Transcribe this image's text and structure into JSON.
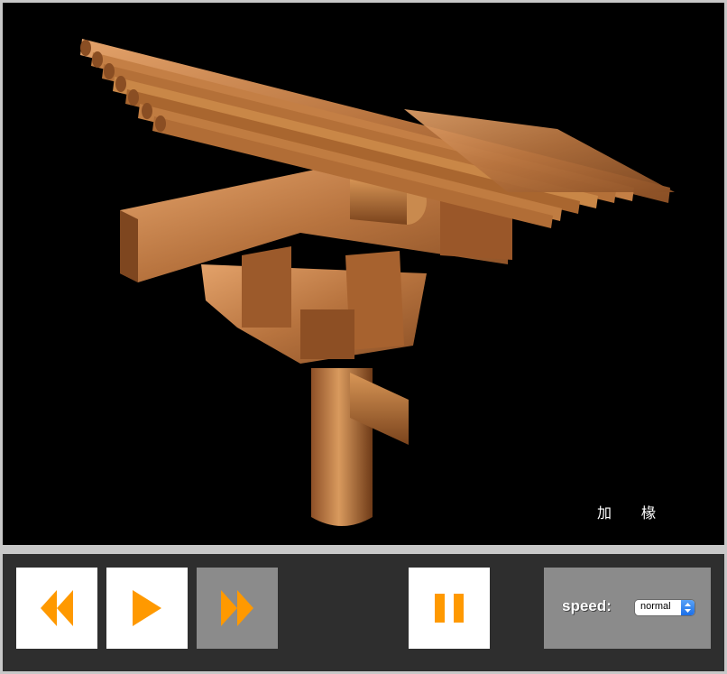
{
  "viewer": {
    "caption": "加 椽",
    "scene": "wooden bracket set (dougong) with rafters on column"
  },
  "controls": {
    "rewind": {
      "icon": "rewind-icon",
      "enabled": true
    },
    "play": {
      "icon": "play-icon",
      "enabled": true
    },
    "forward": {
      "icon": "fast-forward-icon",
      "enabled": false
    },
    "pause": {
      "icon": "pause-icon",
      "enabled": true
    },
    "speed_label": "speed:",
    "speed_value": "normal"
  },
  "colors": {
    "accent": "#ff9900",
    "wood": "#b06a35",
    "panel": "#2e2e2e",
    "disabled": "#8b8b8b"
  }
}
